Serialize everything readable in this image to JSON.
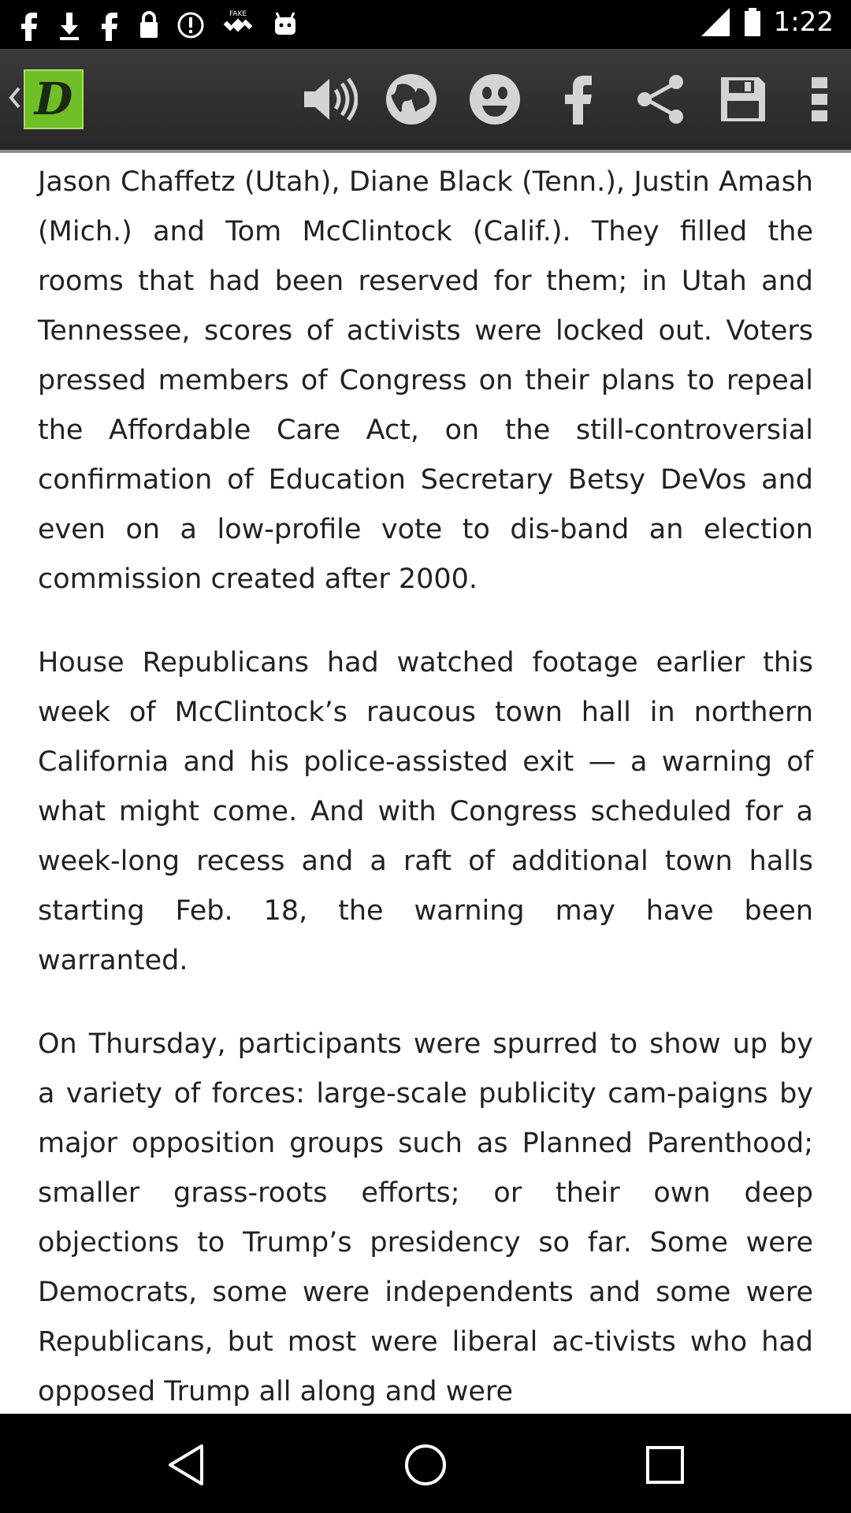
{
  "status_bar": {
    "time": "1:22",
    "left_icons": [
      "facebook-icon",
      "download-icon",
      "facebook-icon",
      "lock-icon",
      "info-icon",
      "fake-gps-icon",
      "android-icon"
    ],
    "right_icons": [
      "signal-icon",
      "battery-icon"
    ]
  },
  "app_bar": {
    "logo_letter": "D",
    "icons": [
      "speaker-icon",
      "globe-icon",
      "emoji-icon",
      "facebook-icon",
      "share-icon",
      "save-icon",
      "overflow-menu-icon"
    ],
    "accent": "#6fbf26"
  },
  "article": {
    "paragraphs": [
      "Jason Chaffetz (Utah), Diane Black (Tenn.), Justin Amash (Mich.) and Tom McClintock (Calif.). They filled the rooms that had been reserved for them; in Utah and Tennessee, scores of activists were locked out. Voters pressed members of Congress on their plans to repeal the Affordable Care Act, on the still-controversial confirmation of Education Secretary Betsy DeVos and even on a low-profile vote to dis-band an election commission created after 2000.",
      "House Republicans had watched footage earlier this week of McClintock’s raucous town hall in northern California and his police-assisted exit — a warning of what might come. And with Congress scheduled for a week-long recess and a raft of additional town halls starting Feb. 18, the warning may have been warranted.",
      "On Thursday, participants were spurred to show up by a variety of forces: large-scale publicity cam-paigns by major opposition groups such as Planned Parenthood; smaller grass-roots efforts; or their own deep objections to Trump’s presidency so far. Some were Democrats, some were independents and some were Republicans, but most were liberal ac-tivists who had opposed Trump all along and were"
    ]
  },
  "nav_bar": {
    "buttons": [
      "back-icon",
      "home-icon",
      "recents-icon"
    ]
  }
}
